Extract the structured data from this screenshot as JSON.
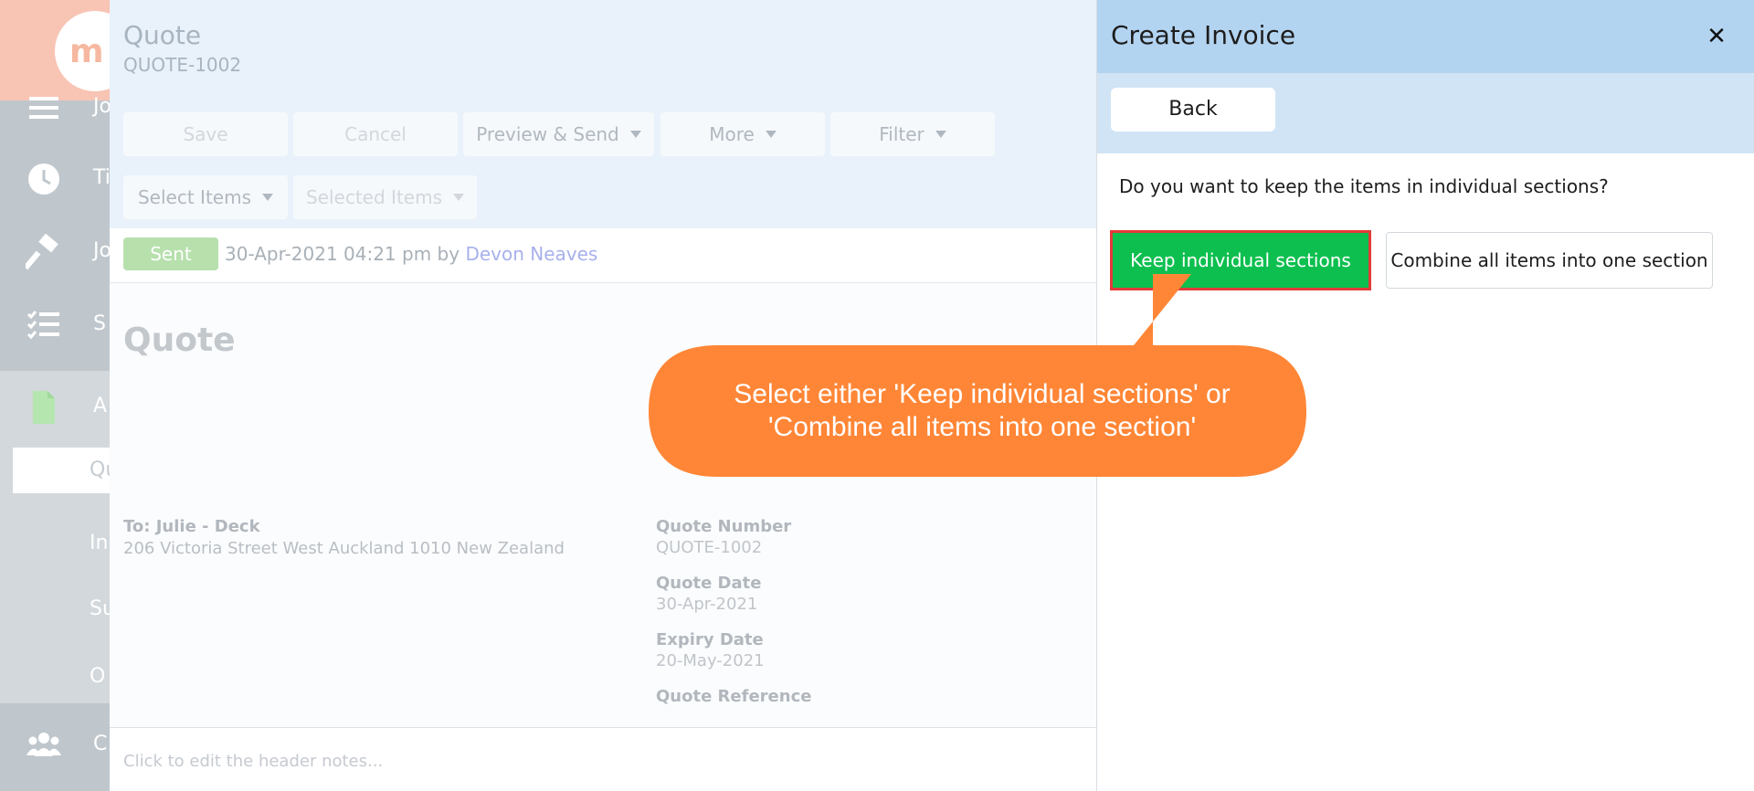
{
  "sidebar": {
    "logo_text": "m",
    "items": [
      {
        "label": "Jo",
        "icon": "menu-icon"
      },
      {
        "label": "Ti",
        "icon": "clock-icon"
      },
      {
        "label": "Jo",
        "icon": "hammer-icon"
      },
      {
        "label": "S",
        "icon": "checklist-icon"
      },
      {
        "label": "A",
        "icon": "document-icon"
      }
    ],
    "sub_items": [
      {
        "label": "Qu",
        "active": true
      },
      {
        "label": "In"
      },
      {
        "label": "Su"
      },
      {
        "label": "O"
      }
    ],
    "bottom_item": {
      "label": "C",
      "icon": "people-icon"
    }
  },
  "quote": {
    "title": "Quote",
    "number": "QUOTE-1002",
    "toolbar": {
      "save": "Save",
      "cancel": "Cancel",
      "preview_send": "Preview & Send",
      "more": "More",
      "filter": "Filter",
      "select_items": "Select Items",
      "selected_items": "Selected Items"
    },
    "status": {
      "badge": "Sent",
      "text": "30-Apr-2021 04:21 pm by",
      "user": "Devon Neaves"
    },
    "doc_title": "Quote",
    "to_label": "To: Julie - Deck",
    "address": "206 Victoria Street West Auckland 1010 New Zealand",
    "fields": [
      {
        "label": "Quote Number",
        "value": "QUOTE-1002"
      },
      {
        "label": "Quote Date",
        "value": "30-Apr-2021"
      },
      {
        "label": "Expiry Date",
        "value": "20-May-2021"
      },
      {
        "label": "Quote Reference",
        "value": ""
      }
    ],
    "header_notes_placeholder": "Click to edit the header notes..."
  },
  "panel": {
    "title": "Create Invoice",
    "close_glyph": "✕",
    "back": "Back",
    "question": "Do you want to keep the items in individual sections?",
    "keep_button": "Keep individual sections",
    "combine_button": "Combine all items into one section"
  },
  "callout": {
    "line1": "Select either 'Keep individual sections' or",
    "line2": "'Combine all items into one section'",
    "color": "#ff8636"
  },
  "colors": {
    "accent_green": "#0dbf4f",
    "highlight_red": "#e33a3a",
    "panel_header": "#b3d4f1"
  }
}
